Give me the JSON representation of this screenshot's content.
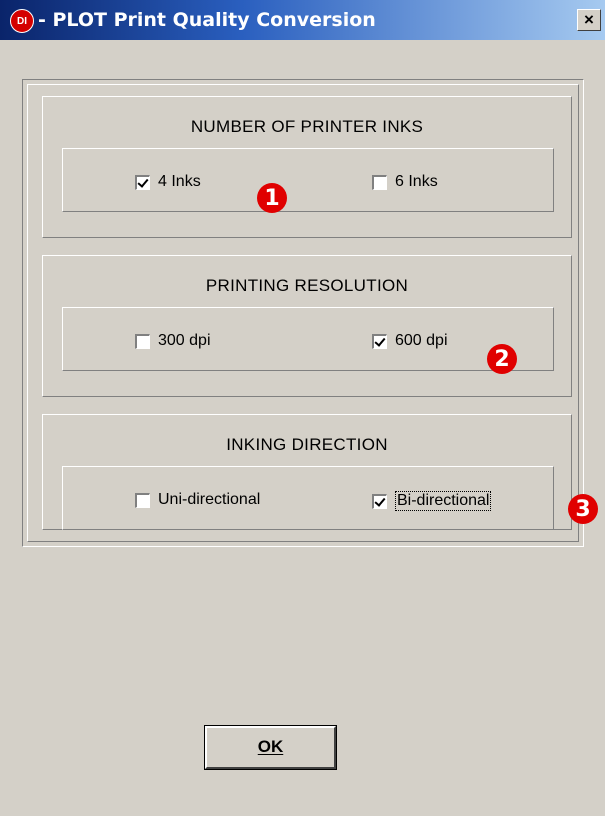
{
  "window": {
    "app_icon_text": "DI",
    "title": "- PLOT Print Quality Conversion",
    "close_glyph": "×"
  },
  "groups": [
    {
      "title": "NUMBER OF PRINTER INKS",
      "options": [
        {
          "label": "4 Inks",
          "checked": true
        },
        {
          "label": "6 Inks",
          "checked": false
        }
      ],
      "badge": "1"
    },
    {
      "title": "PRINTING RESOLUTION",
      "options": [
        {
          "label": "300 dpi",
          "checked": false
        },
        {
          "label": "600 dpi",
          "checked": true
        }
      ],
      "badge": "2"
    },
    {
      "title": "INKING DIRECTION",
      "options": [
        {
          "label": "Uni-directional",
          "checked": false
        },
        {
          "label": "Bi-directional",
          "checked": true
        }
      ],
      "badge": "3"
    }
  ],
  "ok_button": {
    "label": "OK"
  },
  "colors": {
    "dialog_bg": "#d4d0c8",
    "titlebar": "#0a246a",
    "badge": "#e00000"
  }
}
